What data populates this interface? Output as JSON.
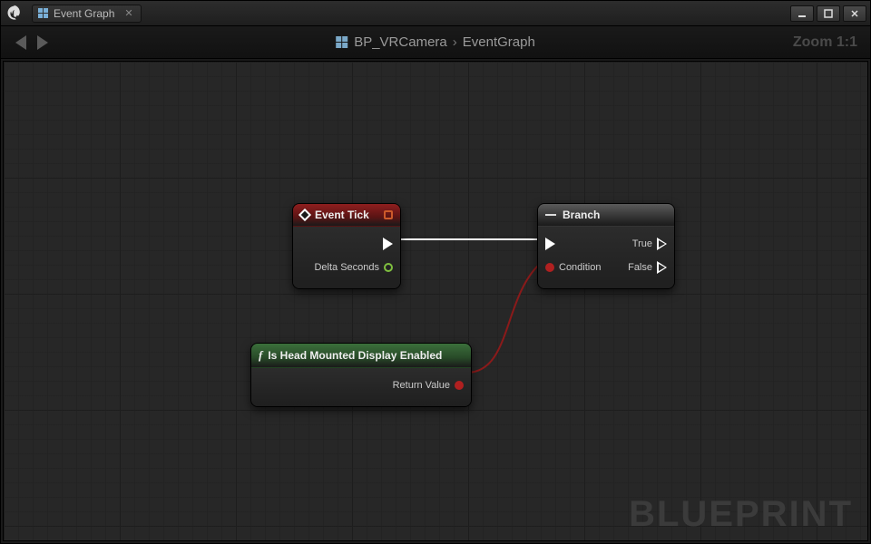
{
  "window": {
    "tab_label": "Event Graph"
  },
  "breadcrumb": {
    "blueprint": "BP_VRCamera",
    "graph": "EventGraph",
    "zoom": "Zoom 1:1"
  },
  "watermark": "BLUEPRINT",
  "nodes": {
    "event_tick": {
      "title": "Event Tick",
      "output_pin": "Delta Seconds"
    },
    "branch": {
      "title": "Branch",
      "condition": "Condition",
      "true": "True",
      "false": "False"
    },
    "hmd_func": {
      "title": "Is Head Mounted Display Enabled",
      "return": "Return Value"
    }
  }
}
